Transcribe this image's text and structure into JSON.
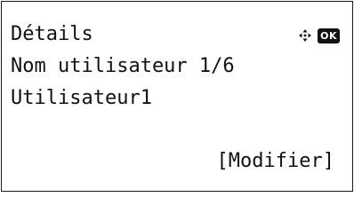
{
  "display": {
    "title": "Détails",
    "field_label": "Nom utilisateur 1/6",
    "field_value": "Utilisateur1",
    "softkey_label": "[Modifier]"
  },
  "indicator": {
    "nav_icon": "four-way-dpad-icon",
    "ok_label": "OK"
  }
}
